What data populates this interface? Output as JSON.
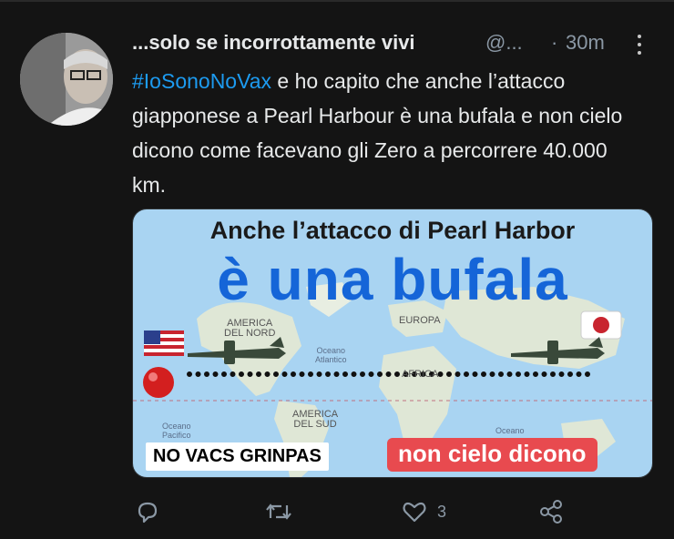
{
  "tweet": {
    "author_name": "...solo se incorrottamente vivi",
    "author_handle": "@...",
    "separator": "·",
    "time": "30m",
    "hashtag": "#IoSonoNoVax",
    "text": " e ho capito che anche l’attacco giapponese a Pearl Harbour è una bufala e non cielo dicono come facevano gli Zero a percorrere 40.000 km."
  },
  "card": {
    "title": "Anche l’attacco di Pearl Harbor",
    "headline": "è una bufala",
    "map_labels": {
      "north_america": "AMERICA\nDEL NORD",
      "europe": "EUROPA",
      "atlantic": "Oceano\nAtlantico",
      "africa": "AFRICA",
      "south_america": "AMERICA\nDEL SUD",
      "pacific": "Oceano\nPacifico",
      "indian": "Oceano"
    },
    "badge_left": "NO VACS GRINPAS",
    "badge_right": "non cielo dicono",
    "colors": {
      "sea": "#a9d4f2",
      "land": "#dfe7d6",
      "headline": "#1565d8",
      "badge_red": "#e84a4f"
    }
  },
  "actions": {
    "reply_icon": "reply-icon",
    "retweet_icon": "retweet-icon",
    "like_icon": "heart-icon",
    "like_count": "3",
    "share_icon": "share-icon"
  }
}
